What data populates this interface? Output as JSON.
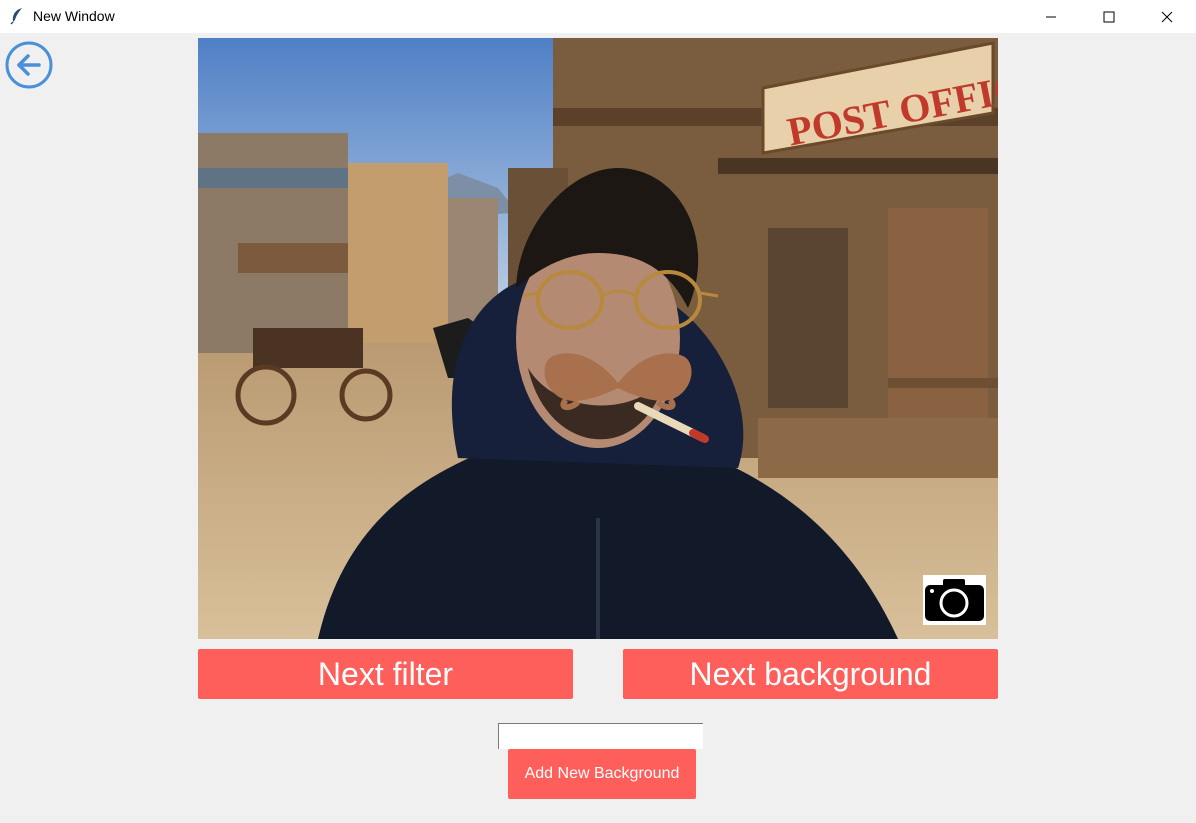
{
  "window": {
    "title": "New Window",
    "app_icon": "feather-icon",
    "controls": [
      "minimize-icon",
      "maximize-icon",
      "close-icon"
    ]
  },
  "back_button": {
    "icon": "arrow-left-icon",
    "color": "#4a90d9"
  },
  "video": {
    "scene": {
      "sign_text": "POST OFFICE"
    },
    "camera_icon": "camera-icon"
  },
  "buttons": {
    "next_filter": "Next filter",
    "next_background": "Next background",
    "add_background": "Add New Background"
  },
  "background_input": {
    "value": "",
    "placeholder": ""
  },
  "colors": {
    "accent": "#ff5f5a",
    "back_icon": "#4a90d9",
    "window_bg": "#f0f0f0"
  }
}
